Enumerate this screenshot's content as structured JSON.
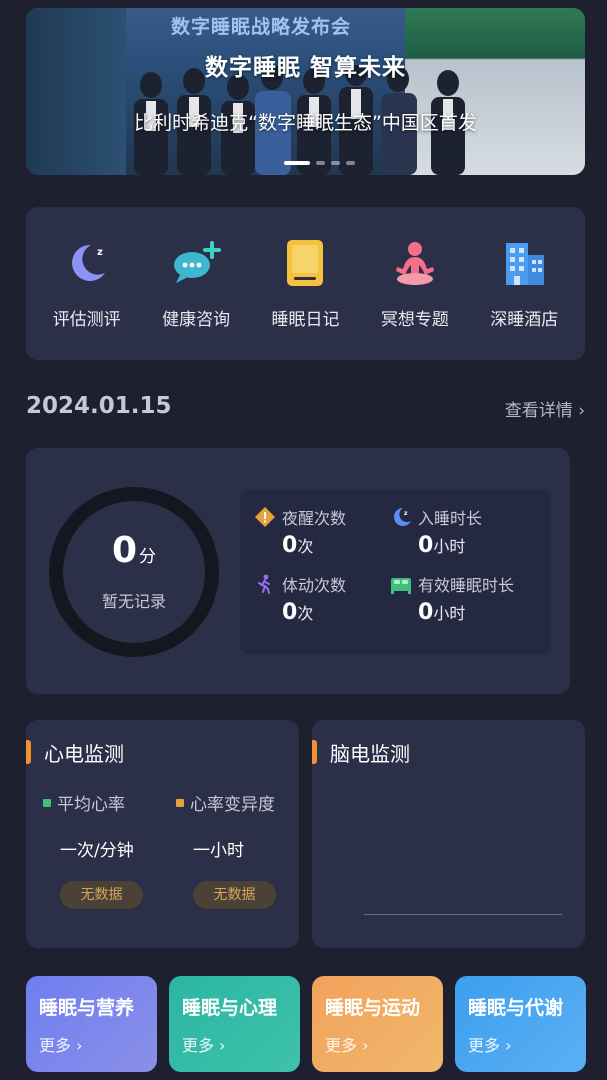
{
  "banner": {
    "stage_sign": "数字睡眠战略发布会",
    "headline": "数字睡眠 智算未来",
    "subline": "比利时希迪克“数字睡眠生态”中国区首发",
    "slides": 5,
    "active_slide": 1
  },
  "quick_menu": [
    {
      "label": "评估测评",
      "icon": "moon-sleep-icon"
    },
    {
      "label": "健康咨询",
      "icon": "chat-bubble-plus-icon"
    },
    {
      "label": "睡眠日记",
      "icon": "diary-book-icon"
    },
    {
      "label": "冥想专题",
      "icon": "meditation-person-icon"
    },
    {
      "label": "深睡酒店",
      "icon": "hotel-building-icon"
    }
  ],
  "date": "2024.01.15",
  "details_link": "查看详情 ›",
  "summary": {
    "score": "0",
    "score_unit": "分",
    "score_note": "暂无记录",
    "stats": [
      {
        "label": "夜醒次数",
        "value": "0",
        "unit": "次",
        "icon": "warning-diamond-icon",
        "color": "#e8a23a"
      },
      {
        "label": "入睡时长",
        "value": "0",
        "unit": "小时",
        "icon": "moon-icon",
        "color": "#5b8ef5"
      },
      {
        "label": "体动次数",
        "value": "0",
        "unit": "次",
        "icon": "running-person-icon",
        "color": "#9a6ef0"
      },
      {
        "label": "有效睡眠时长",
        "value": "0",
        "unit": "小时",
        "icon": "bed-icon",
        "color": "#3fc07a"
      }
    ]
  },
  "ecg": {
    "title": "心电监测",
    "avg_label": "平均心率",
    "avg_value": "一次/分钟",
    "var_label": "心率变异度",
    "var_value": "一小时",
    "nodata": "无数据",
    "avg_color": "#3fbf7a",
    "var_color": "#e6a33c"
  },
  "eeg": {
    "title": "脑电监测"
  },
  "tiles": [
    {
      "title": "睡眠与营养",
      "more": "更多 ›"
    },
    {
      "title": "睡眠与心理",
      "more": "更多 ›"
    },
    {
      "title": "睡眠与运动",
      "more": "更多 ›"
    },
    {
      "title": "睡眠与代谢",
      "more": "更多 ›"
    }
  ]
}
